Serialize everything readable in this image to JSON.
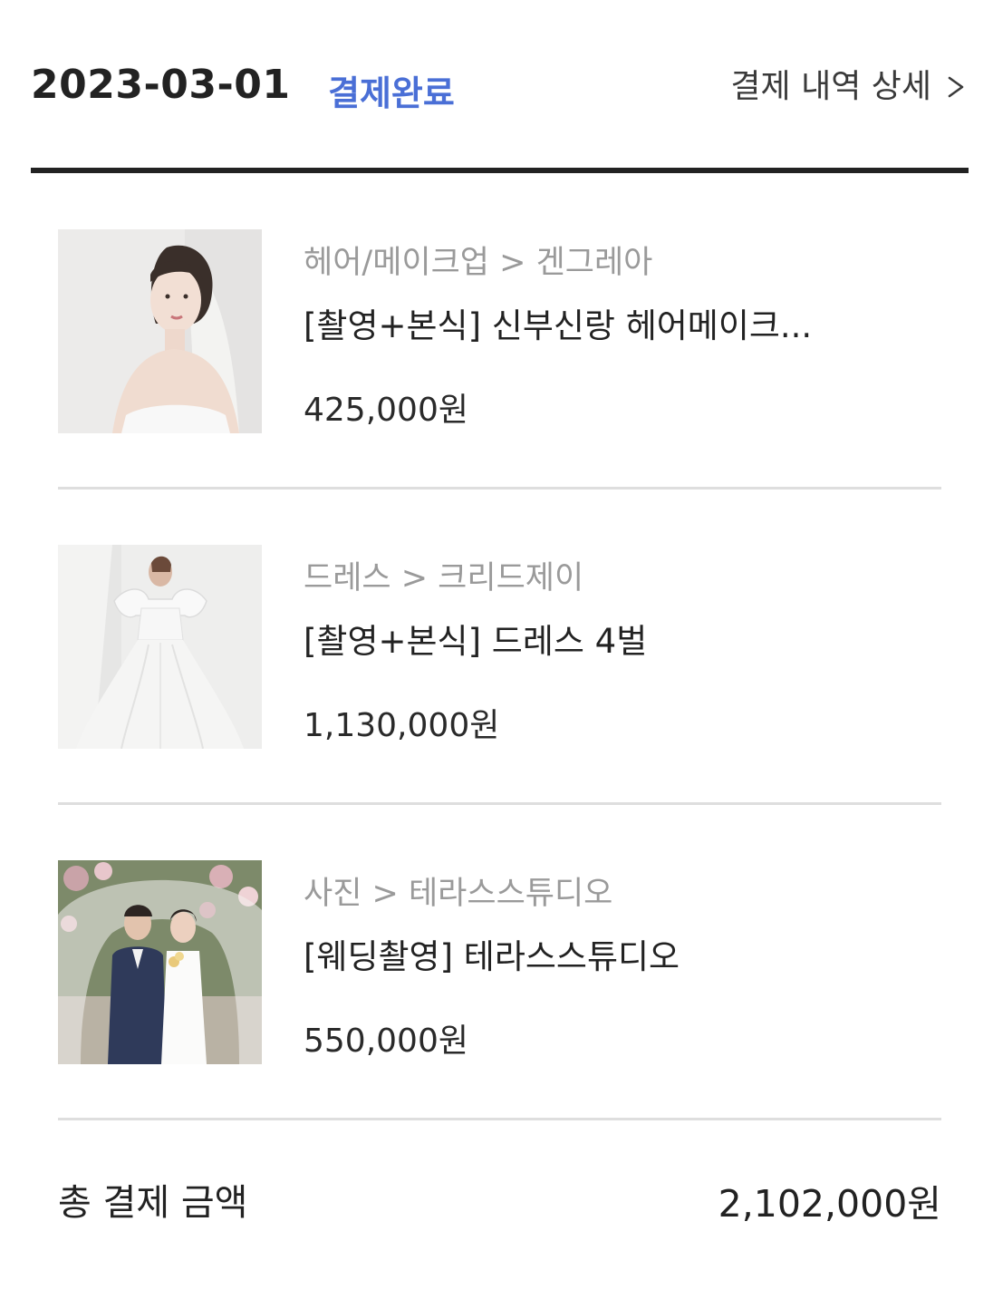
{
  "order": {
    "date": "2023-03-01",
    "status": "결제완료",
    "detail_link": "결제 내역 상세",
    "status_color": "#4a6fd6"
  },
  "items": [
    {
      "category": "헤어/메이크업 > 겐그레아",
      "title": "[촬영+본식] 신부신랑 헤어메이크...",
      "price": "425,000원",
      "image": "bride-portrait-veil"
    },
    {
      "category": "드레스 > 크리드제이",
      "title": "[촬영+본식] 드레스 4벌",
      "price": "1,130,000원",
      "image": "wedding-dress-ballgown"
    },
    {
      "category": "사진 > 테라스스튜디오",
      "title": "[웨딩촬영] 테라스스튜디오",
      "price": "550,000원",
      "image": "couple-under-veil-flowers"
    }
  ],
  "summary": {
    "total_label": "총 결제 금액",
    "total_value": "2,102,000원"
  }
}
